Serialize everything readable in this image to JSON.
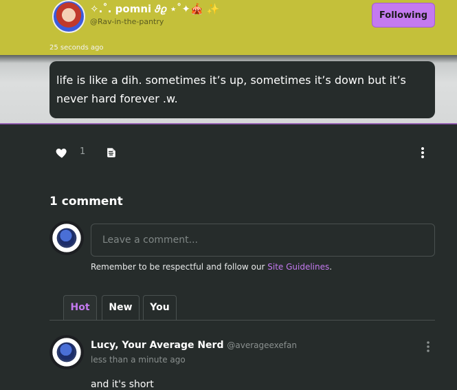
{
  "header": {
    "display_name": "✧.˚. pomni 𝜗𝜚 ⋆˚✦🎪 ✨",
    "handle": "@Rav-in-the-pantry",
    "follow_label": "Following",
    "timestamp": "25 seconds ago",
    "accent_color": "#c4c03a"
  },
  "post": {
    "text": "life is like a dih. sometimes it’s up, sometimes it’s down but it’s never hard forever .w.",
    "like_count": "1",
    "icons": [
      "heart-icon",
      "repost-icon",
      "kebab-menu-icon"
    ]
  },
  "comments": {
    "title": "1 comment",
    "input_placeholder": "Leave a comment...",
    "guidelines_prefix": "Remember to be respectful and follow our ",
    "guidelines_link": "Site Guidelines",
    "guidelines_suffix": ".",
    "link_color": "#c47af0",
    "tabs": [
      {
        "label": "Hot",
        "active": true
      },
      {
        "label": "New",
        "active": false
      },
      {
        "label": "You",
        "active": false
      }
    ],
    "items": [
      {
        "author": "Lucy, Your Average Nerd",
        "handle": "@averageexefan",
        "time": "less than a minute ago",
        "body": "and it's short"
      }
    ]
  }
}
